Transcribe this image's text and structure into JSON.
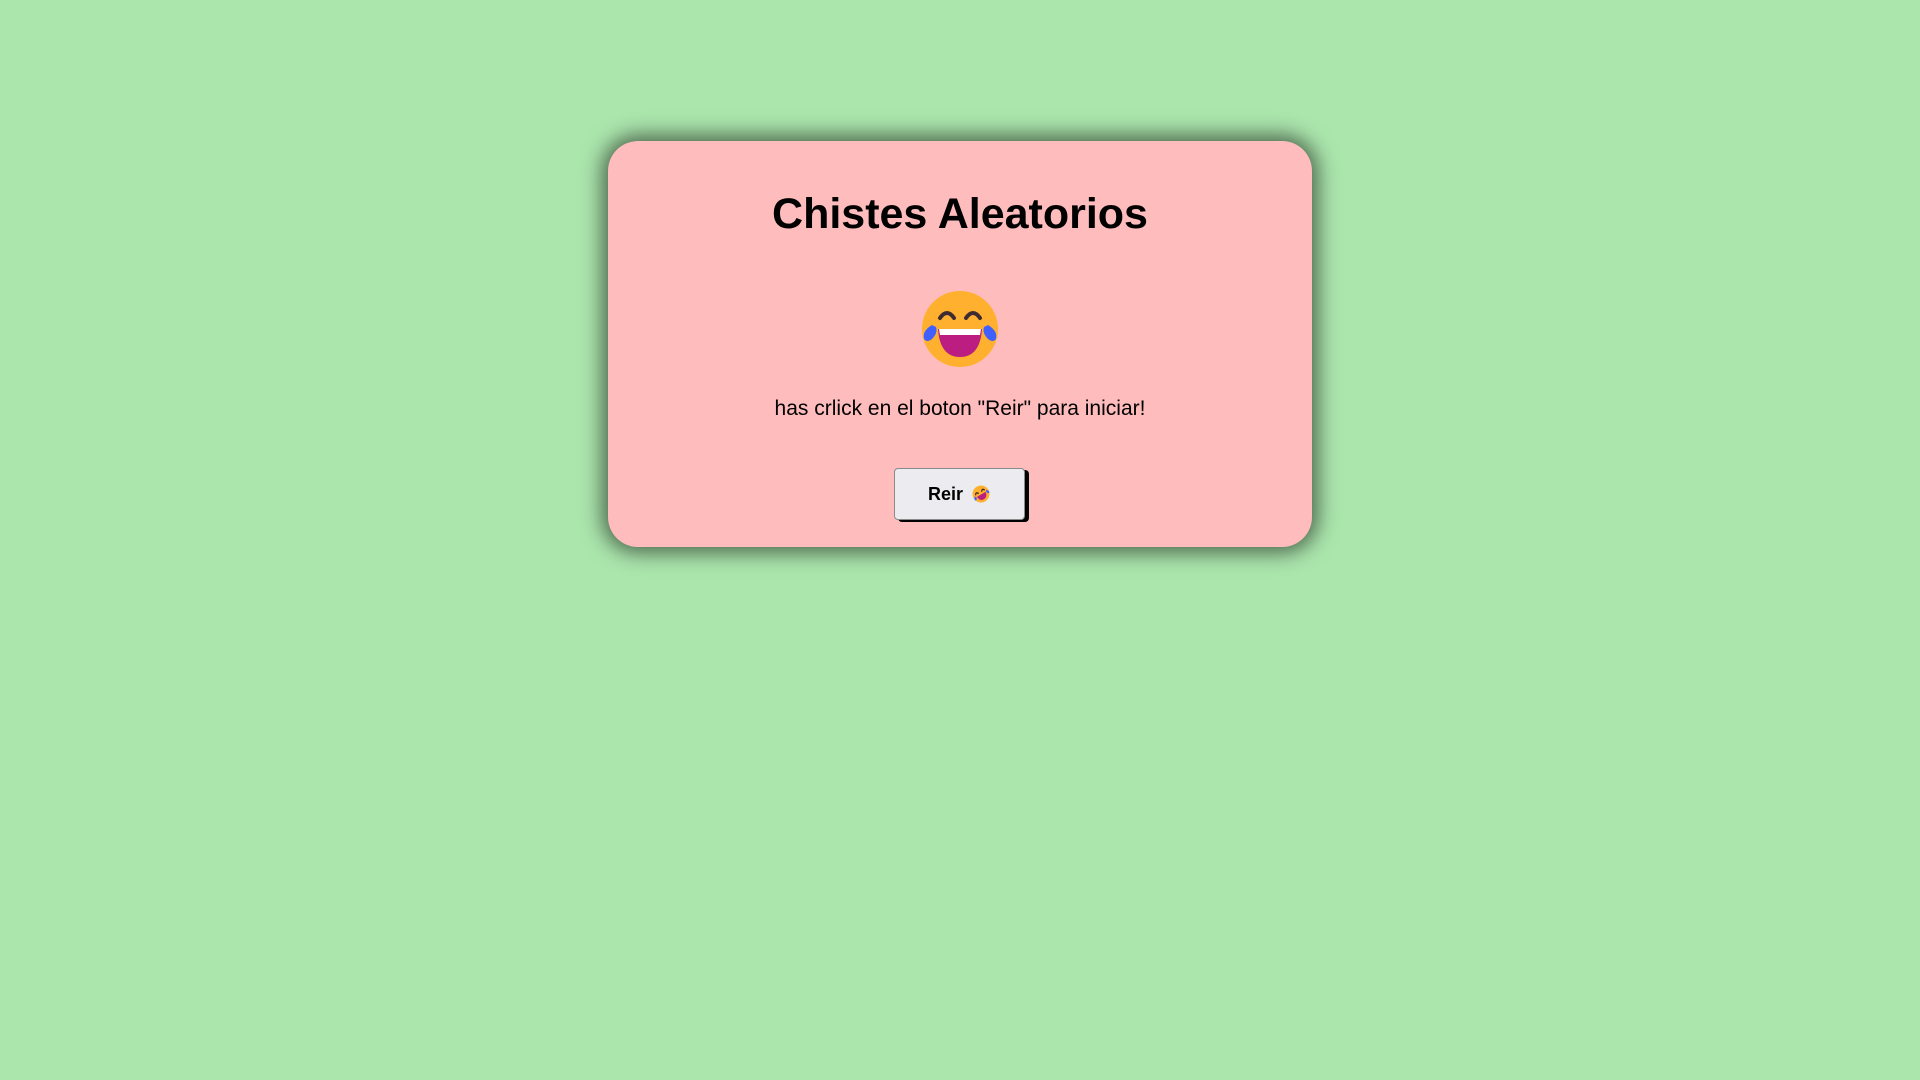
{
  "card": {
    "title": "Chistes Aleatorios",
    "emoji_icon": "face-with-tears-of-joy-icon",
    "message": "has crlick en el boton \"Reir\" para iniciar!",
    "button": {
      "label": "Reir",
      "icon": "rolling-on-floor-laughing-icon"
    }
  },
  "colors": {
    "background": "#abe6ad",
    "card": "#febcbc",
    "button": "#ececf0",
    "emoji_face": "#ffb02e",
    "emoji_tears": "#3f5fff",
    "emoji_mouth": "#bb1d80"
  }
}
